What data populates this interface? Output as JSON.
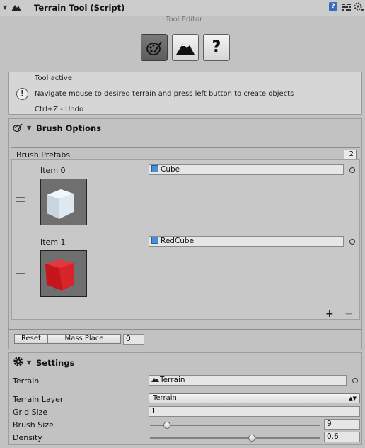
{
  "header": {
    "title": "Terrain Tool (Script)",
    "subtitle": "Tool Editor",
    "help_glyph": "?",
    "icons": [
      "help-icon",
      "preset-icon",
      "settings-gear-icon"
    ]
  },
  "toolbar": {
    "buttons": [
      {
        "name": "brush-tool",
        "icon": "paint-brush-icon",
        "active": true
      },
      {
        "name": "terrain-tool",
        "icon": "mountain-icon",
        "active": false
      },
      {
        "name": "help-tool",
        "label": "?",
        "active": false
      }
    ]
  },
  "help_box": {
    "icon_glyph": "!",
    "line1": "Tool active",
    "line2": "Navigate mouse to desired terrain and press left button to create objects",
    "line3": "Ctrl+Z - Undo"
  },
  "brush_options": {
    "title": "Brush Options",
    "list_label": "Brush Prefabs",
    "count": "2",
    "items": [
      {
        "label": "Item 0",
        "object": "Cube",
        "color": "#d8e4ee"
      },
      {
        "label": "Item 1",
        "object": "RedCube",
        "color": "#d9232a"
      }
    ],
    "add_symbol": "+",
    "remove_symbol": "−",
    "reset_label": "Reset",
    "mass_place_label": "Mass Place",
    "mass_place_value": "0"
  },
  "settings": {
    "title": "Settings",
    "terrain_label": "Terrain",
    "terrain_value": "Terrain",
    "terrain_layer_label": "Terrain Layer",
    "terrain_layer_value": "Terrain",
    "grid_size_label": "Grid Size",
    "grid_size_value": "1",
    "brush_size_label": "Brush Size",
    "brush_size_value": "9",
    "brush_size_fraction": 0.1,
    "density_label": "Density",
    "density_value": "0.6",
    "density_fraction": 0.6
  }
}
